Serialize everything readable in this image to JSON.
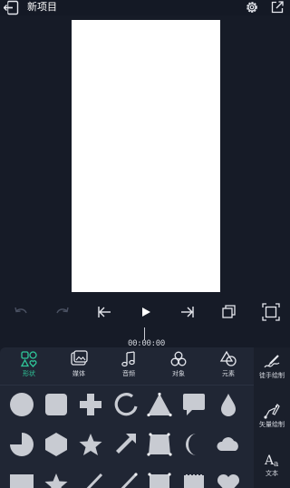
{
  "header": {
    "title": "新项目"
  },
  "timeline": {
    "timecode": "00:00:00"
  },
  "categories": [
    {
      "label": "形状",
      "icon": "shapes-icon"
    },
    {
      "label": "媒体",
      "icon": "media-icon"
    },
    {
      "label": "音频",
      "icon": "music-note-icon"
    },
    {
      "label": "对象",
      "icon": "objects-icon"
    },
    {
      "label": "元素",
      "icon": "elements-icon"
    }
  ],
  "active_category": "形状",
  "side_tools": [
    {
      "label": "徒手绘制",
      "icon": "freehand-draw-icon"
    },
    {
      "label": "矢量绘制",
      "icon": "vector-draw-icon"
    },
    {
      "label": "文本",
      "icon": "text-icon"
    }
  ],
  "shapes": [
    "circle",
    "rounded-square",
    "plus",
    "arc",
    "triangle",
    "speech-bubble",
    "drop",
    "pie",
    "hexagon",
    "star",
    "arrow",
    "parallelogram",
    "crescent",
    "cloud",
    "rectangle",
    "star-small",
    "line",
    "line-diagonal",
    "rectangle-dots",
    "stamp",
    "heart"
  ],
  "colors": {
    "background": "#161b27",
    "panel": "#202634",
    "accent": "#2fc79a",
    "shape_fill": "#c8cbd2"
  }
}
